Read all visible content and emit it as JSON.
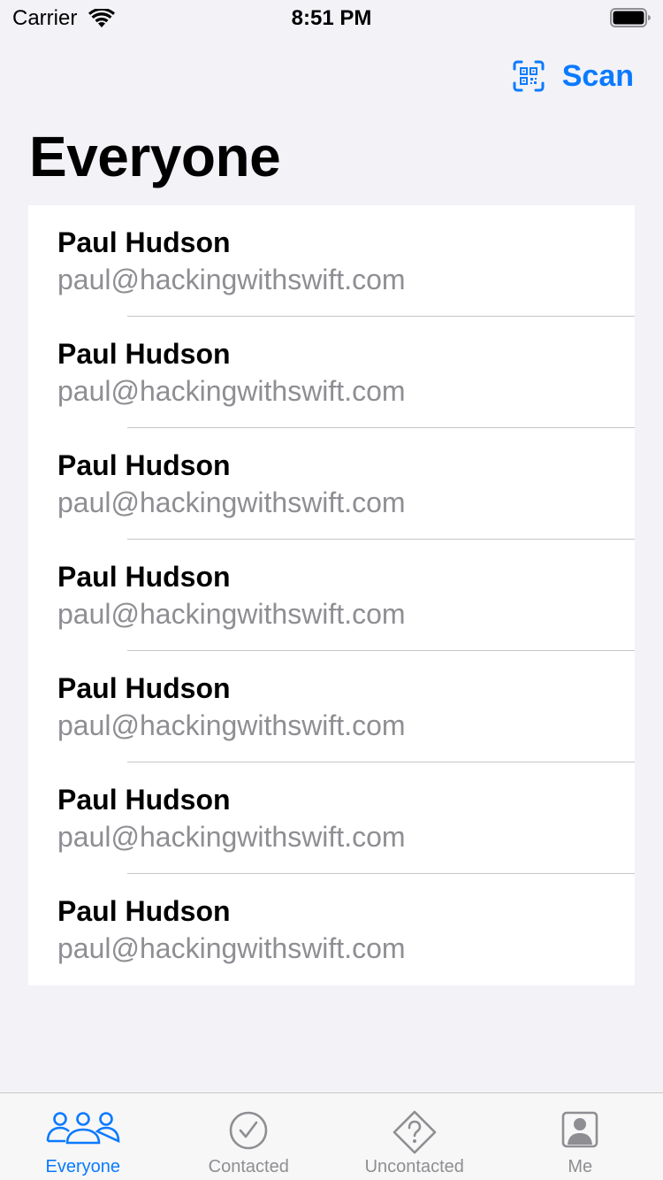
{
  "status_bar": {
    "carrier": "Carrier",
    "time": "8:51 PM",
    "icons": [
      "wifi-icon",
      "battery-icon"
    ]
  },
  "nav": {
    "scan_label": "Scan",
    "scan_icon": "qrcode-viewfinder-icon",
    "title": "Everyone"
  },
  "people": [
    {
      "name": "Paul Hudson",
      "email": "paul@hackingwithswift.com"
    },
    {
      "name": "Paul Hudson",
      "email": "paul@hackingwithswift.com"
    },
    {
      "name": "Paul Hudson",
      "email": "paul@hackingwithswift.com"
    },
    {
      "name": "Paul Hudson",
      "email": "paul@hackingwithswift.com"
    },
    {
      "name": "Paul Hudson",
      "email": "paul@hackingwithswift.com"
    },
    {
      "name": "Paul Hudson",
      "email": "paul@hackingwithswift.com"
    },
    {
      "name": "Paul Hudson",
      "email": "paul@hackingwithswift.com"
    }
  ],
  "tabs": [
    {
      "label": "Everyone",
      "icon": "person-3-icon",
      "active": true
    },
    {
      "label": "Contacted",
      "icon": "checkmark-circle-icon",
      "active": false
    },
    {
      "label": "Uncontacted",
      "icon": "questionmark-diamond-icon",
      "active": false
    },
    {
      "label": "Me",
      "icon": "person-crop-square-icon",
      "active": false
    }
  ],
  "colors": {
    "accent": "#0a7aff",
    "background": "#f2f2f7",
    "secondary_text": "#8e8e93",
    "inactive_tab": "#8e8e93"
  }
}
